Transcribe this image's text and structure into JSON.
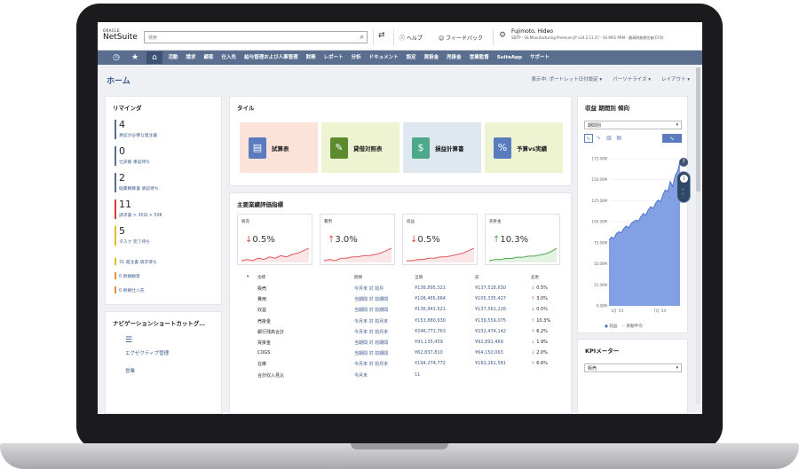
{
  "header": {
    "logo_top": "ORACLE",
    "logo_main": "NetSuite",
    "search_placeholder": "検索",
    "help": "ヘルプ",
    "feedback": "フィードバック",
    "user_name": "Fujimoto, Hideo",
    "user_role": "SDTP - SS Manufacturing Premium JP v24.2 11.27 - SS MFG PRM - 最高財務責任者(CFO)"
  },
  "nav": {
    "items": [
      "活動",
      "請求",
      "顧客",
      "仕入先",
      "給与管理および人事管理",
      "財務",
      "レポート",
      "分析",
      "ドキュメント",
      "設定",
      "買掛金",
      "売掛金",
      "営業監督",
      "SuiteApp",
      "サポート"
    ]
  },
  "page": {
    "title": "ホーム",
    "opt_show": "表示中: ポートレット日付設定",
    "opt_personalize": "パーソナライズ",
    "opt_layout": "レイアウト"
  },
  "reminders": {
    "title": "リマインダ",
    "big": [
      {
        "count": "4",
        "label": "承認が必要な発注書",
        "color": "#5a6f90"
      },
      {
        "count": "0",
        "label": "仕訳帳 承認待ち",
        "color": "#5a6f90"
      },
      {
        "count": "2",
        "label": "経費精算書 承認待ち",
        "color": "#5a6f90"
      },
      {
        "count": "11",
        "label": "請求書 > 30日 > 50K",
        "color": "#d93b3b"
      },
      {
        "count": "5",
        "label": "タスク 完了待ち",
        "color": "#e8b92e"
      }
    ],
    "small": [
      {
        "label": "31 発注書 請求待ち",
        "color": "#e8b92e"
      },
      {
        "label": "0 新規顧客",
        "color": "#e8903a"
      },
      {
        "label": "0 新規仕入先",
        "color": "#e8903a"
      }
    ]
  },
  "nav_shortcuts": {
    "title": "ナビゲーションショートカットグ…",
    "items": [
      "エグゼクティブ管理",
      "営業"
    ]
  },
  "tiles": {
    "title": "タイル",
    "items": [
      {
        "label": "試算表",
        "bg": "#fbe3da",
        "icon": "document-icon",
        "icon_color": "#5b7bbf"
      },
      {
        "label": "貸借対照表",
        "bg": "#eef4d2",
        "icon": "ledger-icon",
        "icon_color": "#5c8a2e"
      },
      {
        "label": "損益計算書",
        "bg": "#dfe8f1",
        "icon": "dollar-icon",
        "icon_color": "#4ba88a"
      },
      {
        "label": "予算vs実績",
        "bg": "#eef4d2",
        "icon": "budget-icon",
        "icon_color": "#5b7bbf"
      }
    ]
  },
  "kpi": {
    "title": "主要業績評価指標",
    "cards": [
      {
        "name": "販売",
        "arrow": "↓",
        "value": "0.5%",
        "arrow_color": "#e04b3c",
        "line_color": "#e05a5a",
        "spark": [
          4,
          5,
          4,
          6,
          5,
          7,
          6,
          8,
          7,
          9,
          10,
          12,
          14
        ]
      },
      {
        "name": "費用",
        "arrow": "↑",
        "value": "3.0%",
        "arrow_color": "#e04b3c",
        "line_color": "#e05a5a",
        "spark": [
          4,
          5,
          4,
          6,
          6,
          7,
          7,
          8,
          8,
          9,
          10,
          12,
          14
        ]
      },
      {
        "name": "収益",
        "arrow": "↓",
        "value": "0.5%",
        "arrow_color": "#e04b3c",
        "line_color": "#e05a5a",
        "spark": [
          4,
          4,
          5,
          5,
          6,
          6,
          7,
          7,
          8,
          9,
          10,
          12,
          14
        ]
      },
      {
        "name": "売掛金",
        "arrow": "↑",
        "value": "10.3%",
        "arrow_color": "#4aa84a",
        "line_color": "#4aa84a",
        "spark": [
          3,
          4,
          4,
          5,
          5,
          6,
          6,
          7,
          7,
          8,
          9,
          11,
          14
        ]
      }
    ],
    "columns": {
      "indicator": "指標",
      "period": "期間",
      "current": "当期",
      "previous": "前",
      "change": "変更"
    },
    "rows": [
      {
        "indicator": "販売",
        "period": "今月末 対 前月",
        "current": "¥136,895,321",
        "previous": "¥137,518,630",
        "arrow": "↓",
        "arrow_color": "#e04b3c",
        "change": "0.5%"
      },
      {
        "indicator": "費用",
        "period": "当期間 対 前期間",
        "current": "¥108,465,664",
        "previous": "¥105,335,427",
        "arrow": "↑",
        "arrow_color": "#e04b3c",
        "change": "3.0%"
      },
      {
        "indicator": "収益",
        "period": "当期間 対 前期間",
        "current": "¥136,941,621",
        "previous": "¥137,561,226",
        "arrow": "↓",
        "arrow_color": "#e04b3c",
        "change": "0.5%"
      },
      {
        "indicator": "売掛金",
        "period": "今月末 対 前月末",
        "current": "¥153,880,630",
        "previous": "¥139,559,075",
        "arrow": "↑",
        "arrow_color": "#4aa84a",
        "change": "10.3%"
      },
      {
        "indicator": "銀行残高合計",
        "period": "今月末 対 前月末",
        "current": "¥246,771,763",
        "previous": "¥232,474,142",
        "arrow": "↑",
        "arrow_color": "#4aa84a",
        "change": "6.2%"
      },
      {
        "indicator": "買掛金",
        "period": "当期間 対 前期間",
        "current": "¥91,135,459",
        "previous": "¥92,891,469",
        "arrow": "↓",
        "arrow_color": "#4aa84a",
        "change": "1.9%"
      },
      {
        "indicator": "COGS",
        "period": "当期間 対 前期間",
        "current": "¥62,837,810",
        "previous": "¥64,150,063",
        "arrow": "↓",
        "arrow_color": "#4aa84a",
        "change": "2.0%"
      },
      {
        "indicator": "在庫",
        "period": "今月末 対 前月末",
        "current": "¥194,274,772",
        "previous": "¥182,261,581",
        "arrow": "↑",
        "arrow_color": "#4aa84a",
        "change": "6.6%"
      },
      {
        "indicator": "合計収入見込",
        "period": "今月末",
        "current": "11",
        "previous": "",
        "arrow": "",
        "arrow_color": "#222",
        "change": ""
      }
    ]
  },
  "trend": {
    "title": "収益 期間別 傾向",
    "select": "期間別",
    "legend_revenue": "収益",
    "legend_moving": "移動平均"
  },
  "kpi_meter": {
    "title": "KPIメーター",
    "select": "販売"
  },
  "chart_data": {
    "type": "area",
    "title": "収益 期間別 傾向",
    "y_ticks": [
      "175.00M",
      "150.00M",
      "125.00M",
      "100.00M",
      "75.00M",
      "50.00M",
      "25.00M",
      "0.00M"
    ],
    "x_ticks": [
      "1月 '24",
      "7月 '24"
    ],
    "ylim": [
      0,
      175
    ],
    "series": [
      {
        "name": "収益",
        "values": [
          78,
          82,
          80,
          86,
          88,
          87,
          92,
          95,
          93,
          98,
          100,
          102,
          101,
          106,
          110,
          108,
          114,
          118,
          116,
          122,
          126,
          124,
          132,
          138,
          136,
          148,
          142,
          155,
          160,
          172
        ]
      }
    ],
    "legend": "bottom"
  }
}
